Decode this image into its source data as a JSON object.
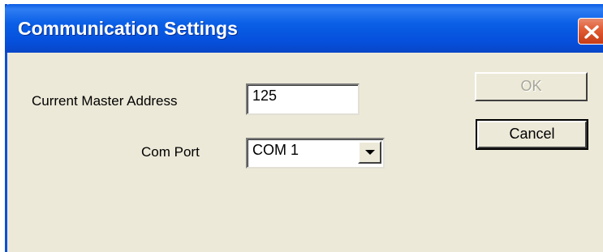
{
  "window": {
    "title": "Communication Settings",
    "close_icon": "close-icon",
    "accent_color": "#0a5fe6",
    "close_color": "#e05a32"
  },
  "form": {
    "master_address_label": "Current Master Address",
    "master_address_value": "125",
    "com_port_label": "Com Port",
    "com_port_value": "COM 1",
    "com_port_arrow_icon": "chevron-down-icon"
  },
  "buttons": {
    "ok_label": "OK",
    "cancel_label": "Cancel"
  }
}
